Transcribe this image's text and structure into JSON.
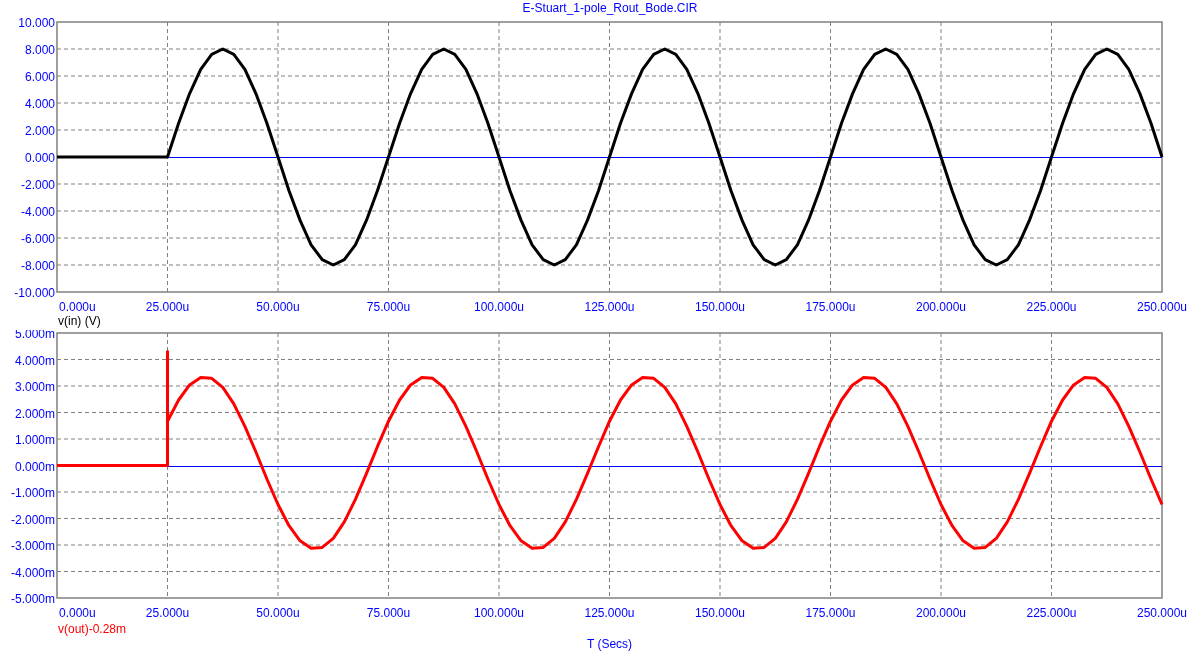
{
  "window": {
    "title": "E-Stuart_1-pole_Rout_Bode.CIR"
  },
  "plots": [
    {
      "chart_data": {
        "type": "line",
        "grid": true,
        "ref_lines": [
          {
            "axis": "y",
            "value": 0,
            "color": "#0000ff"
          }
        ],
        "xlim": [
          0,
          250
        ],
        "ylim": [
          -10,
          10
        ],
        "xticks": [
          {
            "value": 0,
            "label": "0.000u"
          },
          {
            "value": 25,
            "label": "25.000u"
          },
          {
            "value": 50,
            "label": "50.000u"
          },
          {
            "value": 75,
            "label": "75.000u"
          },
          {
            "value": 100,
            "label": "100.000u"
          },
          {
            "value": 125,
            "label": "125.000u"
          },
          {
            "value": 150,
            "label": "150.000u"
          },
          {
            "value": 175,
            "label": "175.000u"
          },
          {
            "value": 200,
            "label": "200.000u"
          },
          {
            "value": 225,
            "label": "225.000u"
          },
          {
            "value": 250,
            "label": "250.000u"
          }
        ],
        "yticks": [
          {
            "value": 10,
            "label": "10.000"
          },
          {
            "value": 8,
            "label": "8.000"
          },
          {
            "value": 6,
            "label": "6.000"
          },
          {
            "value": 4,
            "label": "4.000"
          },
          {
            "value": 2,
            "label": "2.000"
          },
          {
            "value": 0,
            "label": "0.000"
          },
          {
            "value": -2,
            "label": "-2.000"
          },
          {
            "value": -4,
            "label": "-4.000"
          },
          {
            "value": -6,
            "label": "-6.000"
          },
          {
            "value": -8,
            "label": "-8.000"
          },
          {
            "value": -10,
            "label": "-10.000"
          }
        ],
        "x": [
          0,
          2.5,
          5,
          7.5,
          10,
          12.5,
          15,
          17.5,
          20,
          22.5,
          25,
          27.5,
          30,
          32.5,
          35,
          37.5,
          40,
          42.5,
          45,
          47.5,
          50,
          52.5,
          55,
          57.5,
          60,
          62.5,
          65,
          67.5,
          70,
          72.5,
          75,
          77.5,
          80,
          82.5,
          85,
          87.5,
          90,
          92.5,
          95,
          97.5,
          100,
          102.5,
          105,
          107.5,
          110,
          112.5,
          115,
          117.5,
          120,
          122.5,
          125,
          127.5,
          130,
          132.5,
          135,
          137.5,
          140,
          142.5,
          145,
          147.5,
          150,
          152.5,
          155,
          157.5,
          160,
          162.5,
          165,
          167.5,
          170,
          172.5,
          175,
          177.5,
          180,
          182.5,
          185,
          187.5,
          190,
          192.5,
          195,
          197.5,
          200,
          202.5,
          205,
          207.5,
          210,
          212.5,
          215,
          217.5,
          220,
          222.5,
          225,
          227.5,
          230,
          232.5,
          235,
          237.5,
          240,
          242.5,
          245,
          247.5,
          250
        ],
        "series": [
          {
            "name": "v(in) (V)",
            "color": "#000000",
            "values": [
              0,
              0,
              0,
              0,
              0,
              0,
              0,
              0,
              0,
              0,
              0,
              2.5,
              4.7,
              6.5,
              7.6,
              8,
              7.6,
              6.5,
              4.7,
              2.5,
              0,
              -2.5,
              -4.7,
              -6.5,
              -7.6,
              -8,
              -7.6,
              -6.5,
              -4.7,
              -2.5,
              0,
              2.5,
              4.7,
              6.5,
              7.6,
              8,
              7.6,
              6.5,
              4.7,
              2.5,
              0,
              -2.5,
              -4.7,
              -6.5,
              -7.6,
              -8,
              -7.6,
              -6.5,
              -4.7,
              -2.5,
              0,
              2.5,
              4.7,
              6.5,
              7.6,
              8,
              7.6,
              6.5,
              4.7,
              2.5,
              0,
              -2.5,
              -4.7,
              -6.5,
              -7.6,
              -8,
              -7.6,
              -6.5,
              -4.7,
              -2.5,
              0,
              2.5,
              4.7,
              6.5,
              7.6,
              8,
              7.6,
              6.5,
              4.7,
              2.5,
              0,
              -2.5,
              -4.7,
              -6.5,
              -7.6,
              -8,
              -7.6,
              -6.5,
              -4.7,
              -2.5,
              0,
              2.5,
              4.7,
              6.5,
              7.6,
              8,
              7.6,
              6.5,
              4.7,
              2.5,
              0
            ]
          }
        ]
      }
    },
    {
      "chart_data": {
        "type": "line",
        "grid": true,
        "ref_lines": [
          {
            "axis": "y",
            "value": 0,
            "color": "#0000ff"
          }
        ],
        "xlabel": "T (Secs)",
        "xlim": [
          0,
          250
        ],
        "ylim": [
          -5,
          5
        ],
        "xticks": [
          {
            "value": 0,
            "label": "0.000u"
          },
          {
            "value": 25,
            "label": "25.000u"
          },
          {
            "value": 50,
            "label": "50.000u"
          },
          {
            "value": 75,
            "label": "75.000u"
          },
          {
            "value": 100,
            "label": "100.000u"
          },
          {
            "value": 125,
            "label": "125.000u"
          },
          {
            "value": 150,
            "label": "150.000u"
          },
          {
            "value": 175,
            "label": "175.000u"
          },
          {
            "value": 200,
            "label": "200.000u"
          },
          {
            "value": 225,
            "label": "225.000u"
          },
          {
            "value": 250,
            "label": "250.000u"
          }
        ],
        "yticks": [
          {
            "value": 5,
            "label": "5.000m"
          },
          {
            "value": 4,
            "label": "4.000m"
          },
          {
            "value": 3,
            "label": "3.000m"
          },
          {
            "value": 2,
            "label": "2.000m"
          },
          {
            "value": 1,
            "label": "1.000m"
          },
          {
            "value": 0,
            "label": "0.000m"
          },
          {
            "value": -1,
            "label": "-1.000m"
          },
          {
            "value": -2,
            "label": "-2.000m"
          },
          {
            "value": -3,
            "label": "-3.000m"
          },
          {
            "value": -4,
            "label": "-4.000m"
          },
          {
            "value": -5,
            "label": "-5.000m"
          }
        ],
        "x": [
          0,
          2.5,
          5,
          7.5,
          10,
          12.5,
          15,
          17.5,
          20,
          22.5,
          25,
          25,
          25,
          27.5,
          30,
          32.5,
          35,
          37.5,
          40,
          42.5,
          45,
          47.5,
          50,
          52.5,
          55,
          57.5,
          60,
          62.5,
          65,
          67.5,
          70,
          72.5,
          75,
          77.5,
          80,
          82.5,
          85,
          87.5,
          90,
          92.5,
          95,
          97.5,
          100,
          102.5,
          105,
          107.5,
          110,
          112.5,
          115,
          117.5,
          120,
          122.5,
          125,
          127.5,
          130,
          132.5,
          135,
          137.5,
          140,
          142.5,
          145,
          147.5,
          150,
          152.5,
          155,
          157.5,
          160,
          162.5,
          165,
          167.5,
          170,
          172.5,
          175,
          177.5,
          180,
          182.5,
          185,
          187.5,
          190,
          192.5,
          195,
          197.5,
          200,
          202.5,
          205,
          207.5,
          210,
          212.5,
          215,
          217.5,
          220,
          222.5,
          225,
          227.5,
          230,
          232.5,
          235,
          237.5,
          240,
          242.5,
          245,
          247.5,
          250
        ],
        "series": [
          {
            "name": "v(out)-0.28m",
            "color": "#ff0000",
            "values": [
              0,
              0,
              0,
              0,
              0,
              0,
              0,
              0,
              0,
              0,
              0,
              4.3,
              1.67,
              2.47,
              3.04,
              3.32,
              3.29,
              2.95,
              2.33,
              1.48,
              0.51,
              -0.51,
              -1.47,
              -2.27,
              -2.84,
              -3.12,
              -3.09,
              -2.75,
              -2.13,
              -1.28,
              -0.31,
              0.71,
              1.67,
              2.47,
              3.04,
              3.32,
              3.29,
              2.95,
              2.33,
              1.48,
              0.51,
              -0.51,
              -1.47,
              -2.27,
              -2.84,
              -3.12,
              -3.09,
              -2.75,
              -2.13,
              -1.28,
              -0.31,
              0.71,
              1.67,
              2.47,
              3.04,
              3.32,
              3.29,
              2.95,
              2.33,
              1.48,
              0.51,
              -0.51,
              -1.47,
              -2.27,
              -2.84,
              -3.12,
              -3.09,
              -2.75,
              -2.13,
              -1.28,
              -0.31,
              0.71,
              1.67,
              2.47,
              3.04,
              3.32,
              3.29,
              2.95,
              2.33,
              1.48,
              0.51,
              -0.51,
              -1.47,
              -2.27,
              -2.84,
              -3.12,
              -3.09,
              -2.75,
              -2.13,
              -1.28,
              -0.31,
              0.71,
              1.67,
              2.47,
              3.04,
              3.32,
              3.29,
              2.95,
              2.33,
              1.48,
              0.51,
              -0.51,
              -1.47
            ]
          }
        ]
      }
    }
  ]
}
